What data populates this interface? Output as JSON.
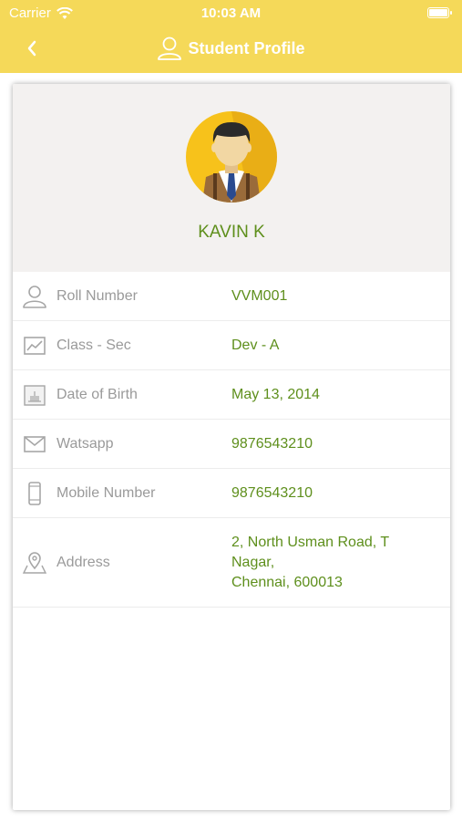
{
  "status_bar": {
    "carrier": "Carrier",
    "time": "10:03 AM"
  },
  "nav": {
    "title": "Student Profile"
  },
  "profile": {
    "name": "KAVIN K"
  },
  "fields": [
    {
      "label": "Roll Number",
      "value": "VVM001",
      "icon": "person-icon"
    },
    {
      "label": "Class - Sec",
      "value": "Dev -  A",
      "icon": "chart-icon"
    },
    {
      "label": "Date of Birth",
      "value": "May 13, 2014",
      "icon": "cake-calendar-icon"
    },
    {
      "label": "Watsapp",
      "value": "9876543210",
      "icon": "mail-icon"
    },
    {
      "label": "Mobile Number",
      "value": "9876543210",
      "icon": "phone-icon"
    },
    {
      "label": "Address",
      "value_lines": [
        "2, North Usman Road, T",
        "Nagar,",
        "Chennai, 600013"
      ],
      "icon": "location-icon"
    }
  ],
  "colors": {
    "header": "#f5d959",
    "accent_text": "#5e8f1c",
    "label_text": "#9a9a9a"
  }
}
